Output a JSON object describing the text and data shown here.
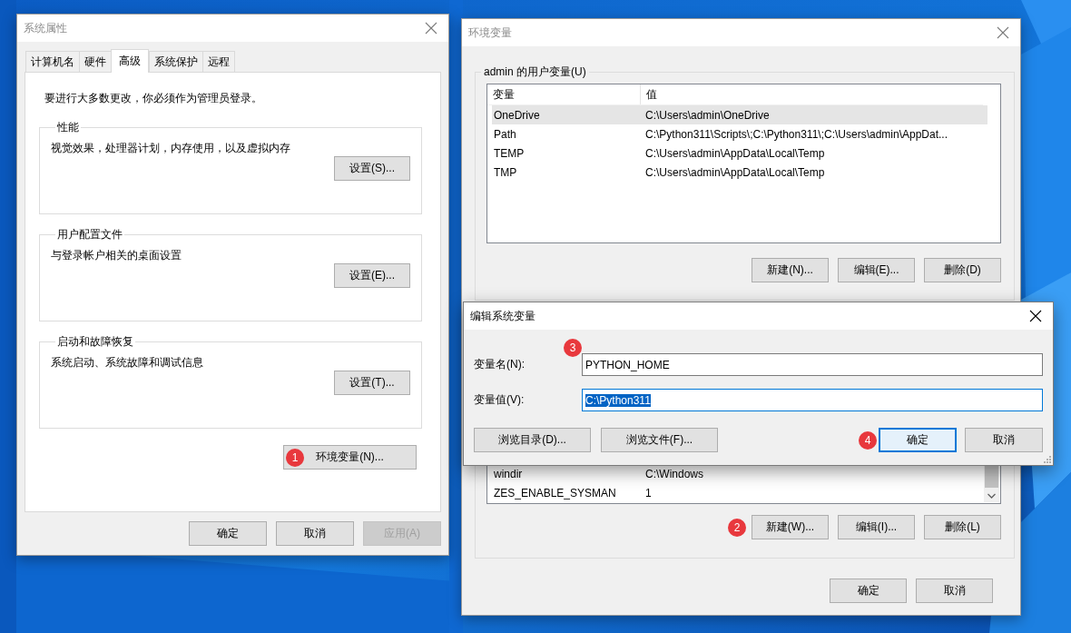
{
  "system_properties": {
    "title": "系统属性",
    "active": false,
    "tabs": [
      {
        "label": "计算机名",
        "selected": false
      },
      {
        "label": "硬件",
        "selected": false
      },
      {
        "label": "高级",
        "selected": true
      },
      {
        "label": "系统保护",
        "selected": false
      },
      {
        "label": "远程",
        "selected": false
      }
    ],
    "notice": "要进行大多数更改，你必须作为管理员登录。",
    "groups": [
      {
        "title": "性能",
        "description": "视觉效果，处理器计划，内存使用，以及虚拟内存",
        "button": "设置(S)..."
      },
      {
        "title": "用户配置文件",
        "description": "与登录帐户相关的桌面设置",
        "button": "设置(E)..."
      },
      {
        "title": "启动和故障恢复",
        "description": "系统启动、系统故障和调试信息",
        "button": "设置(T)..."
      }
    ],
    "env_button": {
      "label": "环境变量(N)...",
      "badge": "1"
    },
    "buttons": [
      {
        "label": "确定",
        "disabled": false
      },
      {
        "label": "取消",
        "disabled": false
      },
      {
        "label": "应用(A)",
        "disabled": true
      }
    ]
  },
  "environment_variables": {
    "title": "环境变量",
    "active": false,
    "user_group": {
      "title": "admin 的用户变量(U)",
      "columns": [
        "变量",
        "值"
      ],
      "rows": [
        {
          "name": "OneDrive",
          "value": "C:\\Users\\admin\\OneDrive",
          "selected": true
        },
        {
          "name": "Path",
          "value": "C:\\Python311\\Scripts\\;C:\\Python311\\;C:\\Users\\admin\\AppDat...",
          "selected": false
        },
        {
          "name": "TEMP",
          "value": "C:\\Users\\admin\\AppData\\Local\\Temp",
          "selected": false
        },
        {
          "name": "TMP",
          "value": "C:\\Users\\admin\\AppData\\Local\\Temp",
          "selected": false
        }
      ],
      "buttons": [
        {
          "label": "新建(N)..."
        },
        {
          "label": "编辑(E)..."
        },
        {
          "label": "删除(D)"
        }
      ]
    },
    "system_group": {
      "rows": [
        {
          "name": "windir",
          "value": "C:\\Windows",
          "selected": false
        },
        {
          "name": "ZES_ENABLE_SYSMAN",
          "value": "1",
          "selected": false
        }
      ],
      "buttons": [
        {
          "label": "新建(W)...",
          "badge": "2"
        },
        {
          "label": "编辑(I)..."
        },
        {
          "label": "删除(L)"
        }
      ]
    },
    "buttons": [
      {
        "label": "确定"
      },
      {
        "label": "取消"
      }
    ]
  },
  "edit_dialog": {
    "title": "编辑系统变量",
    "active": true,
    "fields": [
      {
        "label": "变量名(N):",
        "value": "PYTHON_HOME",
        "text_selected": false,
        "badge": "3"
      },
      {
        "label": "变量值(V):",
        "value": "C:\\Python311",
        "text_selected": true
      }
    ],
    "browse_buttons": [
      {
        "label": "浏览目录(D)..."
      },
      {
        "label": "浏览文件(F)..."
      }
    ],
    "buttons": [
      {
        "label": "确定",
        "focused": true,
        "badge": "4"
      },
      {
        "label": "取消",
        "focused": false
      }
    ]
  }
}
